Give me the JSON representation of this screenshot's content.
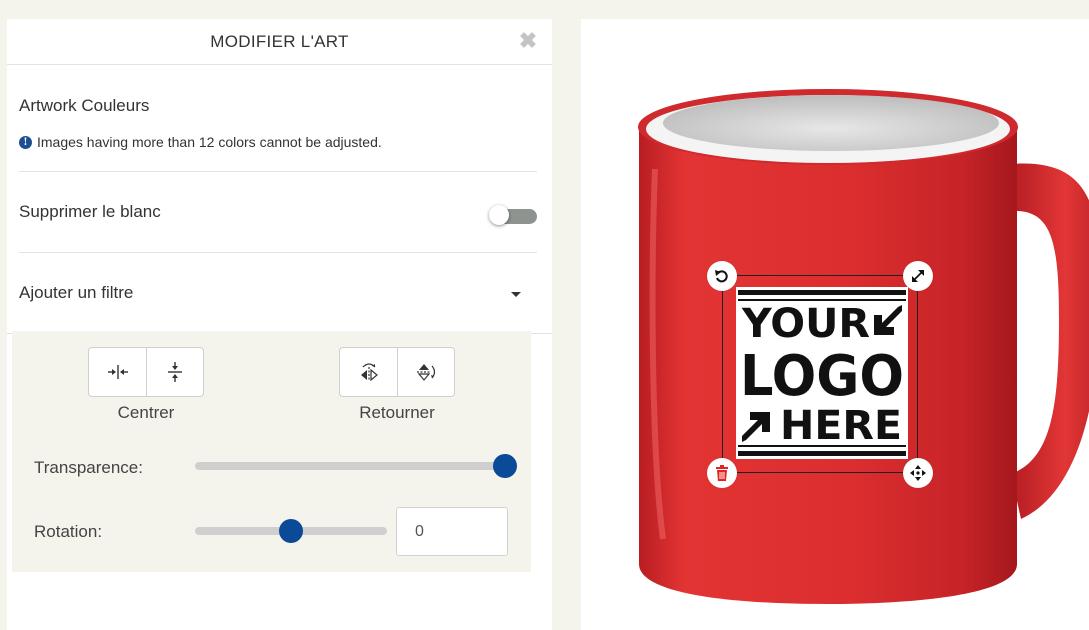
{
  "panel": {
    "title": "MODIFIER L'ART",
    "close_glyph": "✖",
    "artwork_colors": {
      "heading": "Artwork Couleurs",
      "info_glyph": "!",
      "info_text": "Images having more than 12 colors cannot be adjusted."
    },
    "remove_white": {
      "label": "Supprimer le blanc",
      "enabled": false
    },
    "filter": {
      "label": "Ajouter un filtre"
    },
    "tools": {
      "center_label": "Centrer",
      "flip_label": "Retourner",
      "transparency_label": "Transparence:",
      "transparency_value": 1.0,
      "rotation_label": "Rotation:",
      "rotation_slider_fraction": 0.5,
      "rotation_value": "0"
    }
  },
  "preview": {
    "product": "red-mug",
    "logo_lines": [
      "YOUR",
      "LOGO",
      "HERE"
    ],
    "colors": {
      "mug_red": "#dc2e2f",
      "accent_blue": "#0b4a97",
      "delete_red": "#e32222"
    }
  },
  "icons": {
    "close": "close-icon",
    "info": "info-icon",
    "center_horizontal": "center-horizontal-icon",
    "center_vertical": "center-vertical-icon",
    "flip_horizontal": "flip-horizontal-icon",
    "flip_vertical": "flip-vertical-icon",
    "rotate_handle": "rotate-icon",
    "resize_handle": "resize-icon",
    "delete_handle": "trash-icon",
    "move_handle": "move-icon",
    "cursor": "mouse-pointer-icon"
  }
}
